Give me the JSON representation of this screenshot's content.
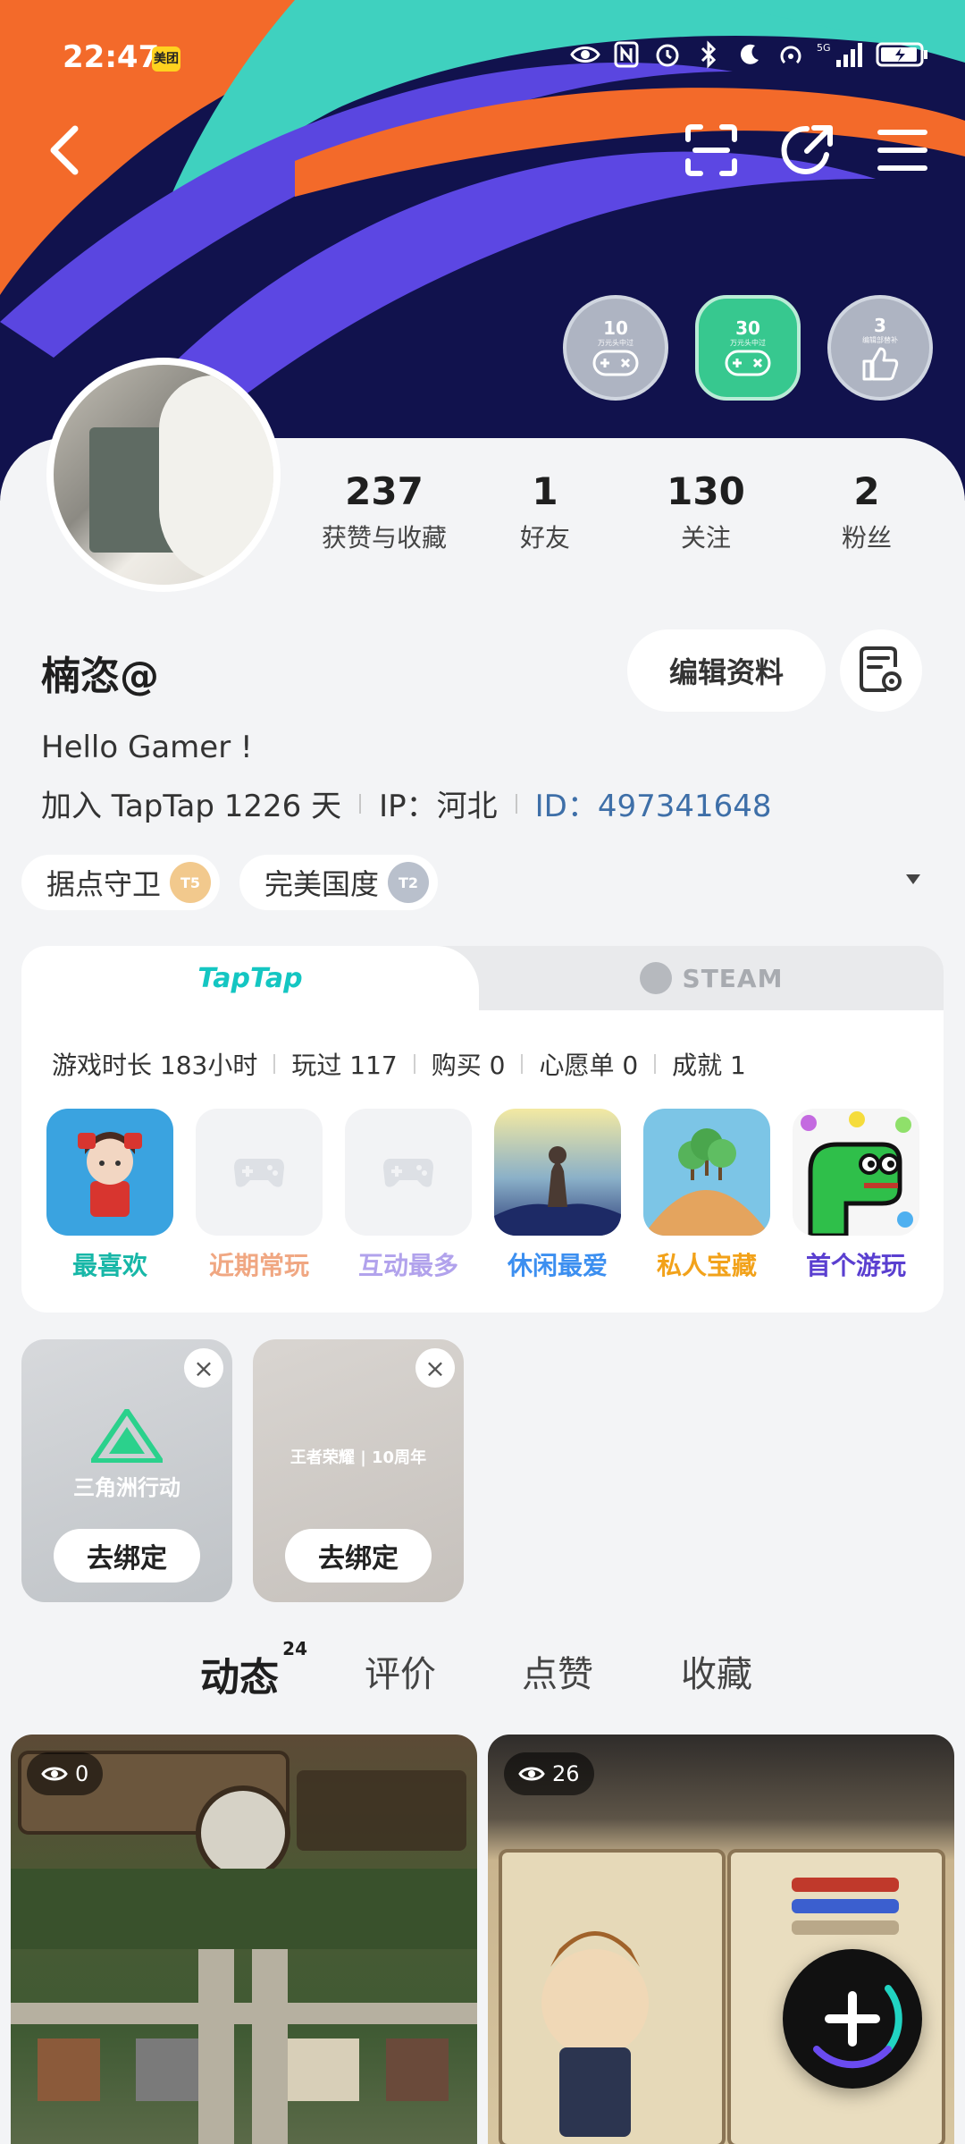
{
  "status_bar": {
    "time": "22:47",
    "app_badge": "美团",
    "network": "5G"
  },
  "header": {
    "medals": [
      {
        "count": "10",
        "caption": "万元头中过"
      },
      {
        "count": "30",
        "caption": "万元头中过"
      },
      {
        "count": "3",
        "caption": "编辑部替补"
      }
    ]
  },
  "profile": {
    "stats": [
      {
        "value": "237",
        "label": "获赞与收藏"
      },
      {
        "value": "1",
        "label": "好友"
      },
      {
        "value": "130",
        "label": "关注"
      },
      {
        "value": "2",
        "label": "粉丝"
      }
    ],
    "username": "楠恣@",
    "edit_label": "编辑资料",
    "bio": "Hello Gamer !",
    "joined": "加入 TapTap 1226 天",
    "ip": "IP：河北",
    "id_label": "ID：",
    "id_value": "497341648",
    "tags": [
      {
        "label": "据点守卫",
        "badge": "T5"
      },
      {
        "label": "完美国度",
        "badge": "T2"
      }
    ]
  },
  "games": {
    "tab_taptap": "TapTap",
    "tab_steam": "STEAM",
    "stats": [
      "游戏时长 183小时",
      "玩过 117",
      "购买 0",
      "心愿单 0",
      "成就 1"
    ],
    "icons": [
      {
        "label": "最喜欢",
        "color": "#17b7a7"
      },
      {
        "label": "近期常玩",
        "color": "#f0a782"
      },
      {
        "label": "互动最多",
        "color": "#b1a2ec"
      },
      {
        "label": "休闲最爱",
        "color": "#3c8ff0"
      },
      {
        "label": "私人宝藏",
        "color": "#f2a21a"
      },
      {
        "label": "首个游玩",
        "color": "#5a3fd0"
      }
    ]
  },
  "bindings": [
    {
      "logo_text": "三角洲行动",
      "button": "去绑定"
    },
    {
      "logo_text": "王者荣耀 | 10周年",
      "button": "去绑定"
    }
  ],
  "content_tabs": [
    {
      "label": "动态",
      "count": "24"
    },
    {
      "label": "评价"
    },
    {
      "label": "点赞"
    },
    {
      "label": "收藏"
    }
  ],
  "posts": [
    {
      "views": "0"
    },
    {
      "views": "26"
    }
  ]
}
